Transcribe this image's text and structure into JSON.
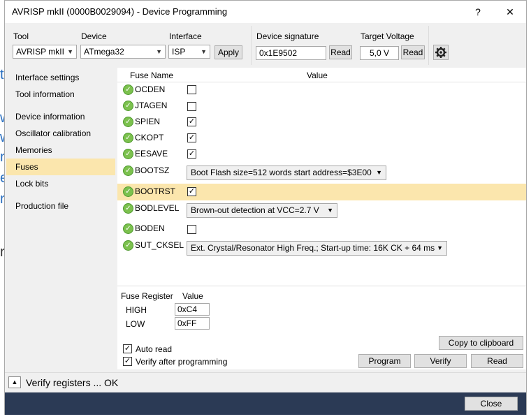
{
  "background_fragments": [
    "t",
    "w",
    "w",
    "rt",
    "el",
    "rn",
    "r"
  ],
  "window": {
    "title": "AVRISP mkII (0000B0029094) - Device Programming",
    "help_label": "?",
    "close_label": "✕"
  },
  "toolbar": {
    "tool_label": "Tool",
    "tool_value": "AVRISP mkII",
    "device_label": "Device",
    "device_value": "ATmega32",
    "interface_label": "Interface",
    "interface_value": "ISP",
    "apply_label": "Apply",
    "signature_label": "Device signature",
    "signature_value": "0x1E9502",
    "signature_read": "Read",
    "voltage_label": "Target Voltage",
    "voltage_value": "5,0 V",
    "voltage_read": "Read",
    "settings_icon": "gear-icon"
  },
  "sidebar": {
    "items": [
      {
        "label": "Interface settings"
      },
      {
        "label": "Tool information"
      },
      {
        "label": "Device information"
      },
      {
        "label": "Oscillator calibration"
      },
      {
        "label": "Memories"
      },
      {
        "label": "Fuses",
        "selected": true
      },
      {
        "label": "Lock bits"
      },
      {
        "label": "Production file"
      }
    ]
  },
  "fuses": {
    "col_name": "Fuse Name",
    "col_value": "Value",
    "rows": [
      {
        "name": "OCDEN",
        "type": "checkbox",
        "checked": false
      },
      {
        "name": "JTAGEN",
        "type": "checkbox",
        "checked": false
      },
      {
        "name": "SPIEN",
        "type": "checkbox",
        "checked": true
      },
      {
        "name": "CKOPT",
        "type": "checkbox",
        "checked": true
      },
      {
        "name": "EESAVE",
        "type": "checkbox",
        "checked": true
      },
      {
        "name": "BOOTSZ",
        "type": "select",
        "value": "Boot Flash size=512 words start address=$3E00"
      },
      {
        "name": "BOOTRST",
        "type": "checkbox",
        "checked": true,
        "selected": true
      },
      {
        "name": "BODLEVEL",
        "type": "select",
        "value": "Brown-out detection at VCC=2.7 V"
      },
      {
        "name": "BODEN",
        "type": "checkbox",
        "checked": false
      },
      {
        "name": "SUT_CKSEL",
        "type": "select",
        "value": "Ext. Crystal/Resonator High Freq.; Start-up time: 16K CK + 64 ms"
      }
    ]
  },
  "registers": {
    "col_register": "Fuse Register",
    "col_value": "Value",
    "high_label": "HIGH",
    "high_value": "0xC4",
    "low_label": "LOW",
    "low_value": "0xFF"
  },
  "options": {
    "auto_read_label": "Auto read",
    "auto_read_checked": true,
    "verify_label": "Verify after programming",
    "verify_checked": true
  },
  "actions": {
    "copy_label": "Copy to clipboard",
    "program_label": "Program",
    "verify_label": "Verify",
    "read_label": "Read"
  },
  "status": {
    "text": "Verify registers ... OK",
    "toggle_glyph": "▲"
  },
  "footer": {
    "close_label": "Close"
  },
  "colors": {
    "selection": "#fbe6ad",
    "footer": "#2b3a55",
    "ok_icon": "#7cc14e"
  }
}
